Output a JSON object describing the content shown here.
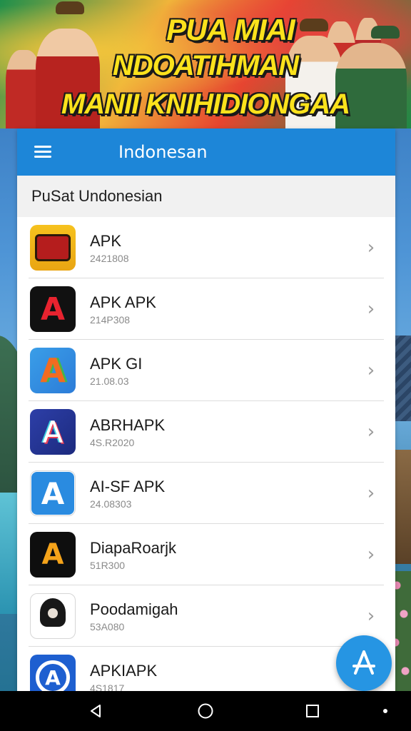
{
  "banner": {
    "line1": "PUA MIAI",
    "line2": "NDOATIHMAN",
    "line3": "MANII KNIHIDIONGAA"
  },
  "appbar": {
    "title": "Indonesan",
    "menu_icon": "hamburger-menu-icon",
    "color": "#1d86d8"
  },
  "section": {
    "title": "PuSat Undonesian"
  },
  "apps": [
    {
      "name": "APK",
      "meta": "2421808",
      "icon": "game-badge-icon"
    },
    {
      "name": "APK APK",
      "meta": "214P308",
      "icon": "red-a-logo-icon"
    },
    {
      "name": "APK GI",
      "meta": "21.08.03",
      "icon": "colorful-a-logo-icon"
    },
    {
      "name": "ABRHAPK",
      "meta": "4S.R2020",
      "icon": "gradient-a-logo-icon"
    },
    {
      "name": "AI-SF APK",
      "meta": "24.08303",
      "icon": "blue-a-tile-icon"
    },
    {
      "name": "DiapaRoarjk",
      "meta": "51R300",
      "icon": "orange-a-logo-icon"
    },
    {
      "name": "Poodamigah",
      "meta": "53A080",
      "icon": "hooded-figure-icon"
    },
    {
      "name": "APKIAPK",
      "meta": "4S1817",
      "icon": "circle-a-logo-icon"
    }
  ],
  "fab": {
    "icon": "app-store-icon",
    "color": "#2695e3"
  },
  "navbar": {
    "back_icon": "back-triangle-icon",
    "home_icon": "home-circle-icon",
    "recents_icon": "recents-square-icon",
    "extra_icon": "dot-icon"
  }
}
